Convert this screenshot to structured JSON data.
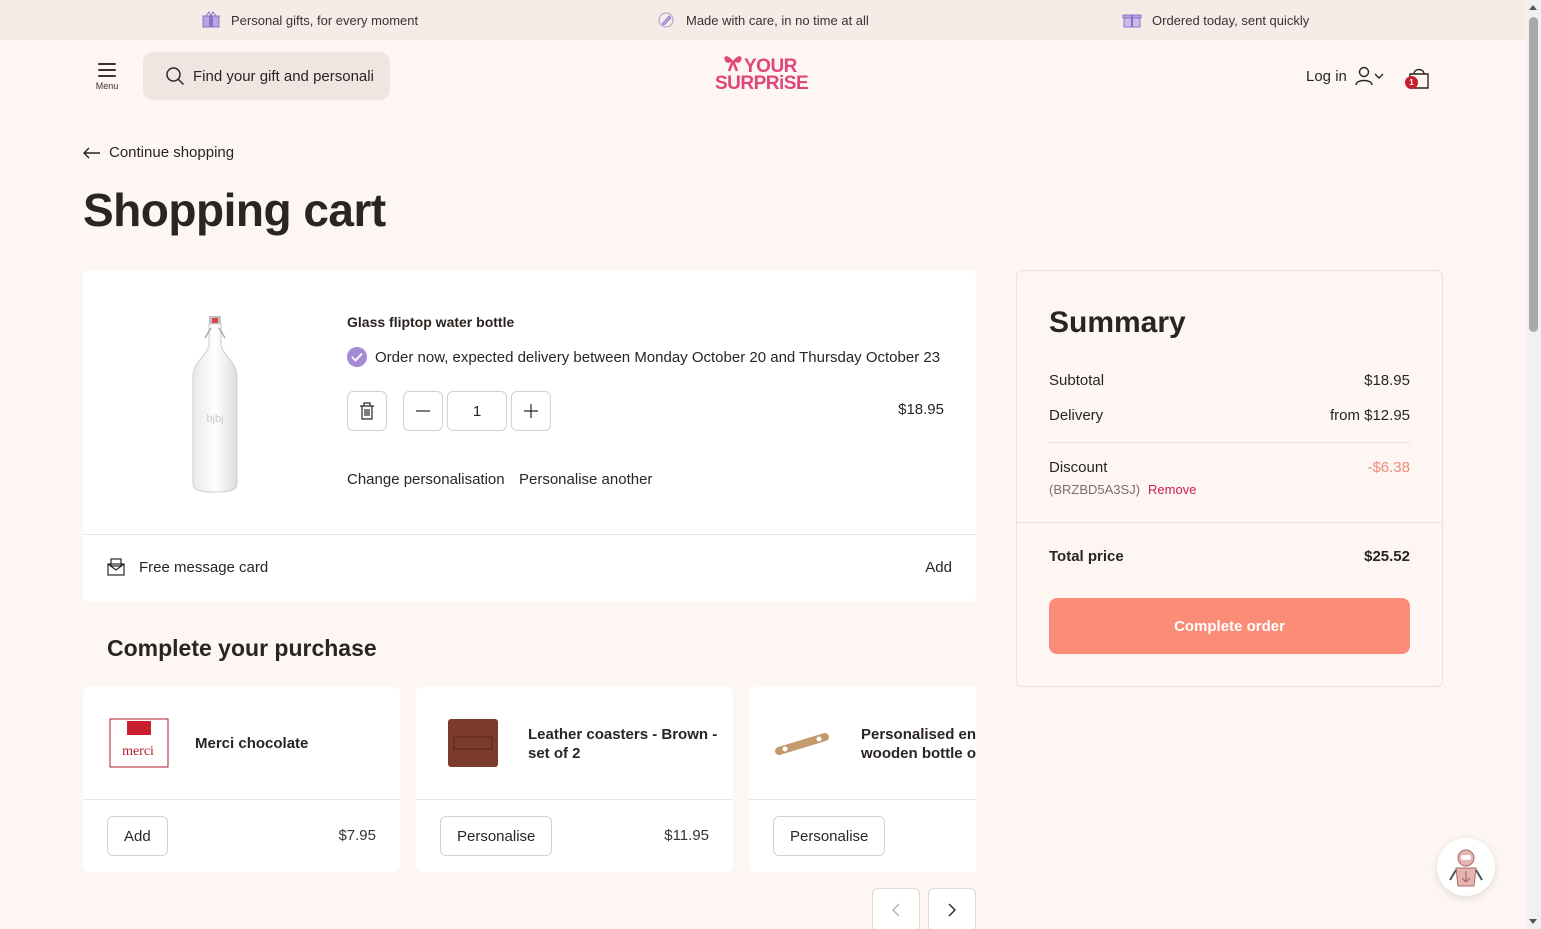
{
  "promo": [
    {
      "text": "Personal gifts, for every moment",
      "icon": "gift-box-icon"
    },
    {
      "text": "Made with care, in no time at all",
      "icon": "pencil-icon"
    },
    {
      "text": "Ordered today, sent quickly",
      "icon": "present-icon"
    }
  ],
  "header": {
    "menu_label": "Menu",
    "search_placeholder": "Find your gift and personali",
    "logo_line1": "YOUR",
    "logo_line2": "SURPRiSE",
    "login_label": "Log in",
    "cart_count": "1"
  },
  "nav": {
    "continue_label": "Continue shopping"
  },
  "page_title": "Shopping cart",
  "cart_item": {
    "title": "Glass fliptop water bottle",
    "delivery_text": "Order now, expected delivery between Monday October 20 and Thursday October 23",
    "quantity": "1",
    "price": "$18.95",
    "change_personalisation": "Change personalisation",
    "personalise_another": "Personalise another",
    "bottle_text": "bjbj"
  },
  "message_card": {
    "label": "Free message card",
    "action": "Add"
  },
  "upsell": {
    "title": "Complete your purchase",
    "products": [
      {
        "name": "Merci chocolate",
        "button": "Add",
        "price": "$7.95",
        "thumb_text": "merci"
      },
      {
        "name": "Leather coasters - Brown - set of 2",
        "button": "Personalise",
        "price": "$11.95"
      },
      {
        "name": "Personalised engraved wooden bottle opener",
        "button": "Personalise",
        "price": ""
      }
    ]
  },
  "summary": {
    "title": "Summary",
    "subtotal_label": "Subtotal",
    "subtotal_value": "$18.95",
    "delivery_label": "Delivery",
    "delivery_value": "from $12.95",
    "discount_label": "Discount",
    "discount_value": "-$6.38",
    "discount_code": "(BRZBD5A3SJ)",
    "remove_label": "Remove",
    "total_label": "Total price",
    "total_value": "$25.52",
    "cta_label": "Complete order"
  },
  "colors": {
    "background": "#fdf6f2",
    "brand_pink": "#e0457b",
    "cta": "#fb8c78",
    "discount": "#f08a78",
    "check": "#a58ad4"
  }
}
